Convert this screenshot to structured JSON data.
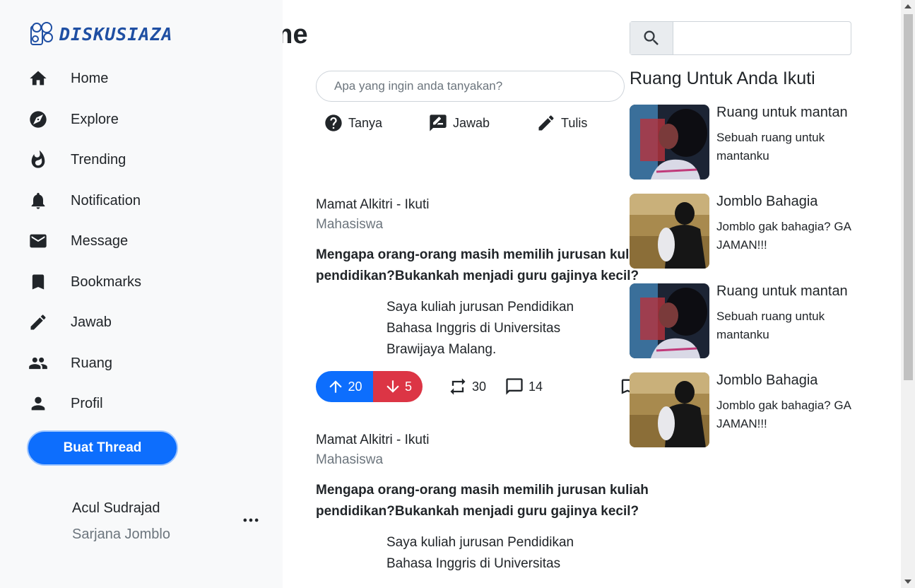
{
  "page": {
    "title": "Home"
  },
  "ask": {
    "placeholder": "Apa yang ingin anda tanyakan?"
  },
  "actions": [
    {
      "label": "Tanya",
      "icon": "question-icon"
    },
    {
      "label": "Jawab",
      "icon": "answer-icon"
    },
    {
      "label": "Tulis",
      "icon": "pencil-icon"
    }
  ],
  "posts": [
    {
      "author": "Mamat Alkitri - Ikuti",
      "role": "Mahasiswa",
      "question": "Mengapa orang-orang masih memilih jurusan kuliah pendidikan?Bukankah menjadi guru gajinya kecil?",
      "answer": "Saya kuliah jurusan Pendidikan Bahasa Inggris di Universitas Brawijaya Malang.",
      "upvotes": "20",
      "downvotes": "5",
      "reposts": "30",
      "comments": "14"
    },
    {
      "author": "Mamat Alkitri - Ikuti",
      "role": "Mahasiswa",
      "question": "Mengapa orang-orang masih memilih jurusan kuliah pendidikan?Bukankah menjadi guru gajinya kecil?",
      "answer": "Saya kuliah jurusan Pendidikan Bahasa Inggris di Universitas"
    }
  ],
  "search": {
    "placeholder": ""
  },
  "rooms": {
    "title": "Ruang Untuk Anda Ikuti",
    "items": [
      {
        "name": "Ruang untuk mantan",
        "desc": "Sebuah ruang untuk mantanku"
      },
      {
        "name": "Jomblo Bahagia",
        "desc": "Jomblo gak bahagia? GA JAMAN!!!"
      },
      {
        "name": "Ruang untuk mantan",
        "desc": "Sebuah ruang untuk mantanku"
      },
      {
        "name": "Jomblo Bahagia",
        "desc": "Jomblo gak bahagia? GA JAMAN!!!"
      }
    ]
  },
  "sidebar": {
    "brand": "DISKUSIAZA",
    "items": [
      {
        "label": "Home",
        "icon": "home-icon"
      },
      {
        "label": "Explore",
        "icon": "compass-icon"
      },
      {
        "label": "Trending",
        "icon": "fire-icon"
      },
      {
        "label": "Notification",
        "icon": "bell-icon"
      },
      {
        "label": "Message",
        "icon": "mail-icon"
      },
      {
        "label": "Bookmarks",
        "icon": "bookmark-icon"
      },
      {
        "label": "Jawab",
        "icon": "pencil-icon"
      },
      {
        "label": "Ruang",
        "icon": "group-icon"
      },
      {
        "label": "Profil",
        "icon": "person-icon"
      }
    ],
    "button": "Buat Thread",
    "user": {
      "name": "Acul Sudrajad",
      "role": "Sarjana Jomblo"
    }
  },
  "colors": {
    "primary": "#0d6efd",
    "danger": "#dc3545",
    "sidebar_bg": "#f8f9fa",
    "brand": "#1f4fa3"
  }
}
